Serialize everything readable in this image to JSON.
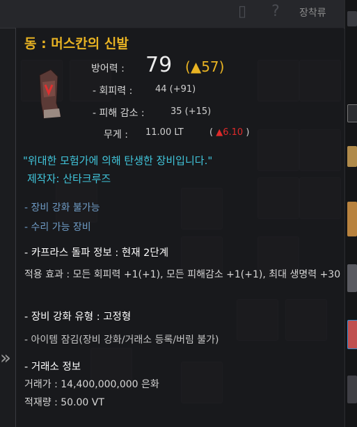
{
  "background": {
    "tab_label": "장착류"
  },
  "tooltip": {
    "title": "동 : 머스칸의 신발",
    "defense": {
      "label": "방어력 :",
      "value": "79",
      "delta_open": "(",
      "delta": "▲57",
      "delta_close": ")"
    },
    "evasion": {
      "label": "- 회피력 :",
      "value": "44 (+91)"
    },
    "damage_reduction": {
      "label": "- 피해 감소 :",
      "value": "35 (+15)"
    },
    "weight": {
      "label": "무게 :",
      "value": "11.00 LT",
      "delta_open": "(",
      "delta": "▲6.10",
      "delta_close": ")"
    },
    "description": "\"위대한 모험가에 의해 탄생한 장비입니다.\"",
    "maker": "제작자: 산타크루즈",
    "enhance_status": "- 장비 강화 불가능",
    "repair_status": "- 수리 가능 장비",
    "caphras": {
      "heading": "- 카프라스 돌파 정보 : 현재 2단계",
      "effect": "적용 효과 : 모든 회피력 +1(+1), 모든 피해감소 +1(+1), 최대 생명력 +30"
    },
    "enhance_type": "- 장비 강화 유형 : 고정형",
    "lock": "- 아이템 잠김(장비 강화/거래소 등록/버림 불가)",
    "market": {
      "heading": "- 거래소 정보",
      "price": "거래가 : 14,400,000,000 은화",
      "weight": "적재량 : 50.00 VT"
    }
  },
  "colors": {
    "title": "#e8b323",
    "cyan": "#41c7dd",
    "muted_blue": "#6f9cc6",
    "red": "#e02a2a"
  }
}
